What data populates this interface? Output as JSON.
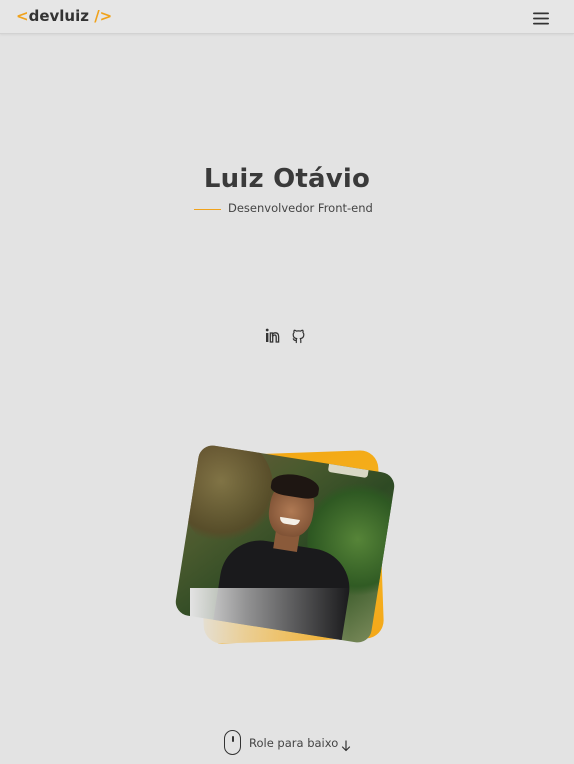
{
  "header": {
    "logo": {
      "open": "<",
      "name": "devluiz",
      "close": "/>"
    },
    "menu_icon": "hamburger-menu-icon"
  },
  "hero": {
    "name": "Luiz Otávio",
    "role": "Desenvolvedor Front-end",
    "social": [
      {
        "icon": "linkedin-icon"
      },
      {
        "icon": "github-icon"
      }
    ]
  },
  "scroll": {
    "label": "Role para baixo",
    "icon": "mouse-icon",
    "arrow_icon": "arrow-down-icon"
  },
  "colors": {
    "accent": "#f0a21b",
    "background": "#e3e3e3",
    "text": "#333333"
  }
}
